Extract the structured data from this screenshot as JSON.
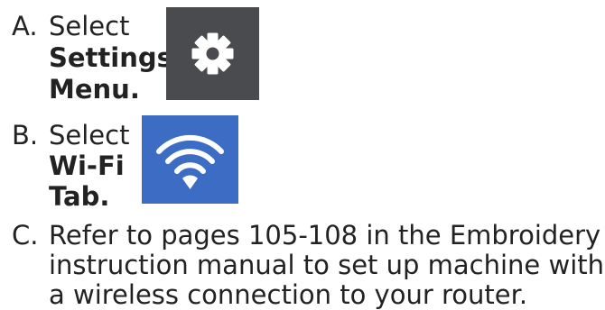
{
  "steps": [
    {
      "letter": "A.",
      "verb": "Select",
      "target_line1": "Settings",
      "target_line2": "Menu.",
      "icon": "gear-icon",
      "icon_bg": "#4a4b4f",
      "icon_fg": "#ffffff"
    },
    {
      "letter": "B.",
      "verb": "Select",
      "target_line1": "Wi-Fi",
      "target_line2": "Tab.",
      "icon": "wifi-icon",
      "icon_bg": "#3d6cc4",
      "icon_fg": "#ffffff"
    },
    {
      "letter": "C.",
      "lines": [
        "Refer to pages 105-108 in the Embroidery",
        "instruction manual to set up machine with",
        "a wireless connection to your router."
      ]
    }
  ]
}
